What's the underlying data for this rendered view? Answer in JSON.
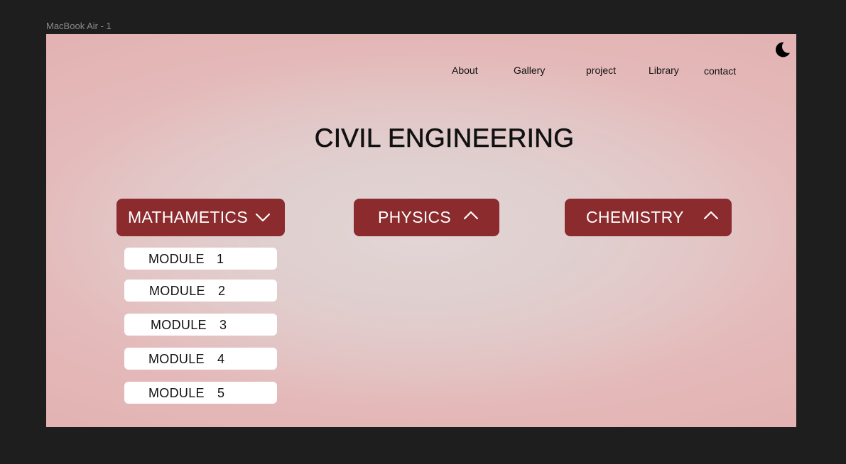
{
  "canvas": {
    "frame_label": "MacBook Air - 1"
  },
  "theme_toggle": {
    "icon": "moon-icon"
  },
  "nav": {
    "items": [
      {
        "label": "About"
      },
      {
        "label": "Gallery"
      },
      {
        "label": "project"
      },
      {
        "label": "Library"
      },
      {
        "label": "contact"
      }
    ]
  },
  "page": {
    "title": "CIVIL ENGINEERING"
  },
  "subjects": [
    {
      "label": "MATHAMETICS",
      "chevron": "chevron-down-icon",
      "expanded": true
    },
    {
      "label": "PHYSICS",
      "chevron": "chevron-up-icon",
      "expanded": false
    },
    {
      "label": "CHEMISTRY",
      "chevron": "chevron-up-icon",
      "expanded": false
    }
  ],
  "modules": [
    {
      "label": "MODULE",
      "number": "1"
    },
    {
      "label": "MODULE",
      "number": "2"
    },
    {
      "label": "MODULE",
      "number": "3"
    },
    {
      "label": "MODULE",
      "number": "4"
    },
    {
      "label": "MODULE",
      "number": "5"
    }
  ],
  "colors": {
    "accent": "#8b2b2e",
    "background": "#e3b1b1",
    "canvas": "#1e1e1e"
  }
}
